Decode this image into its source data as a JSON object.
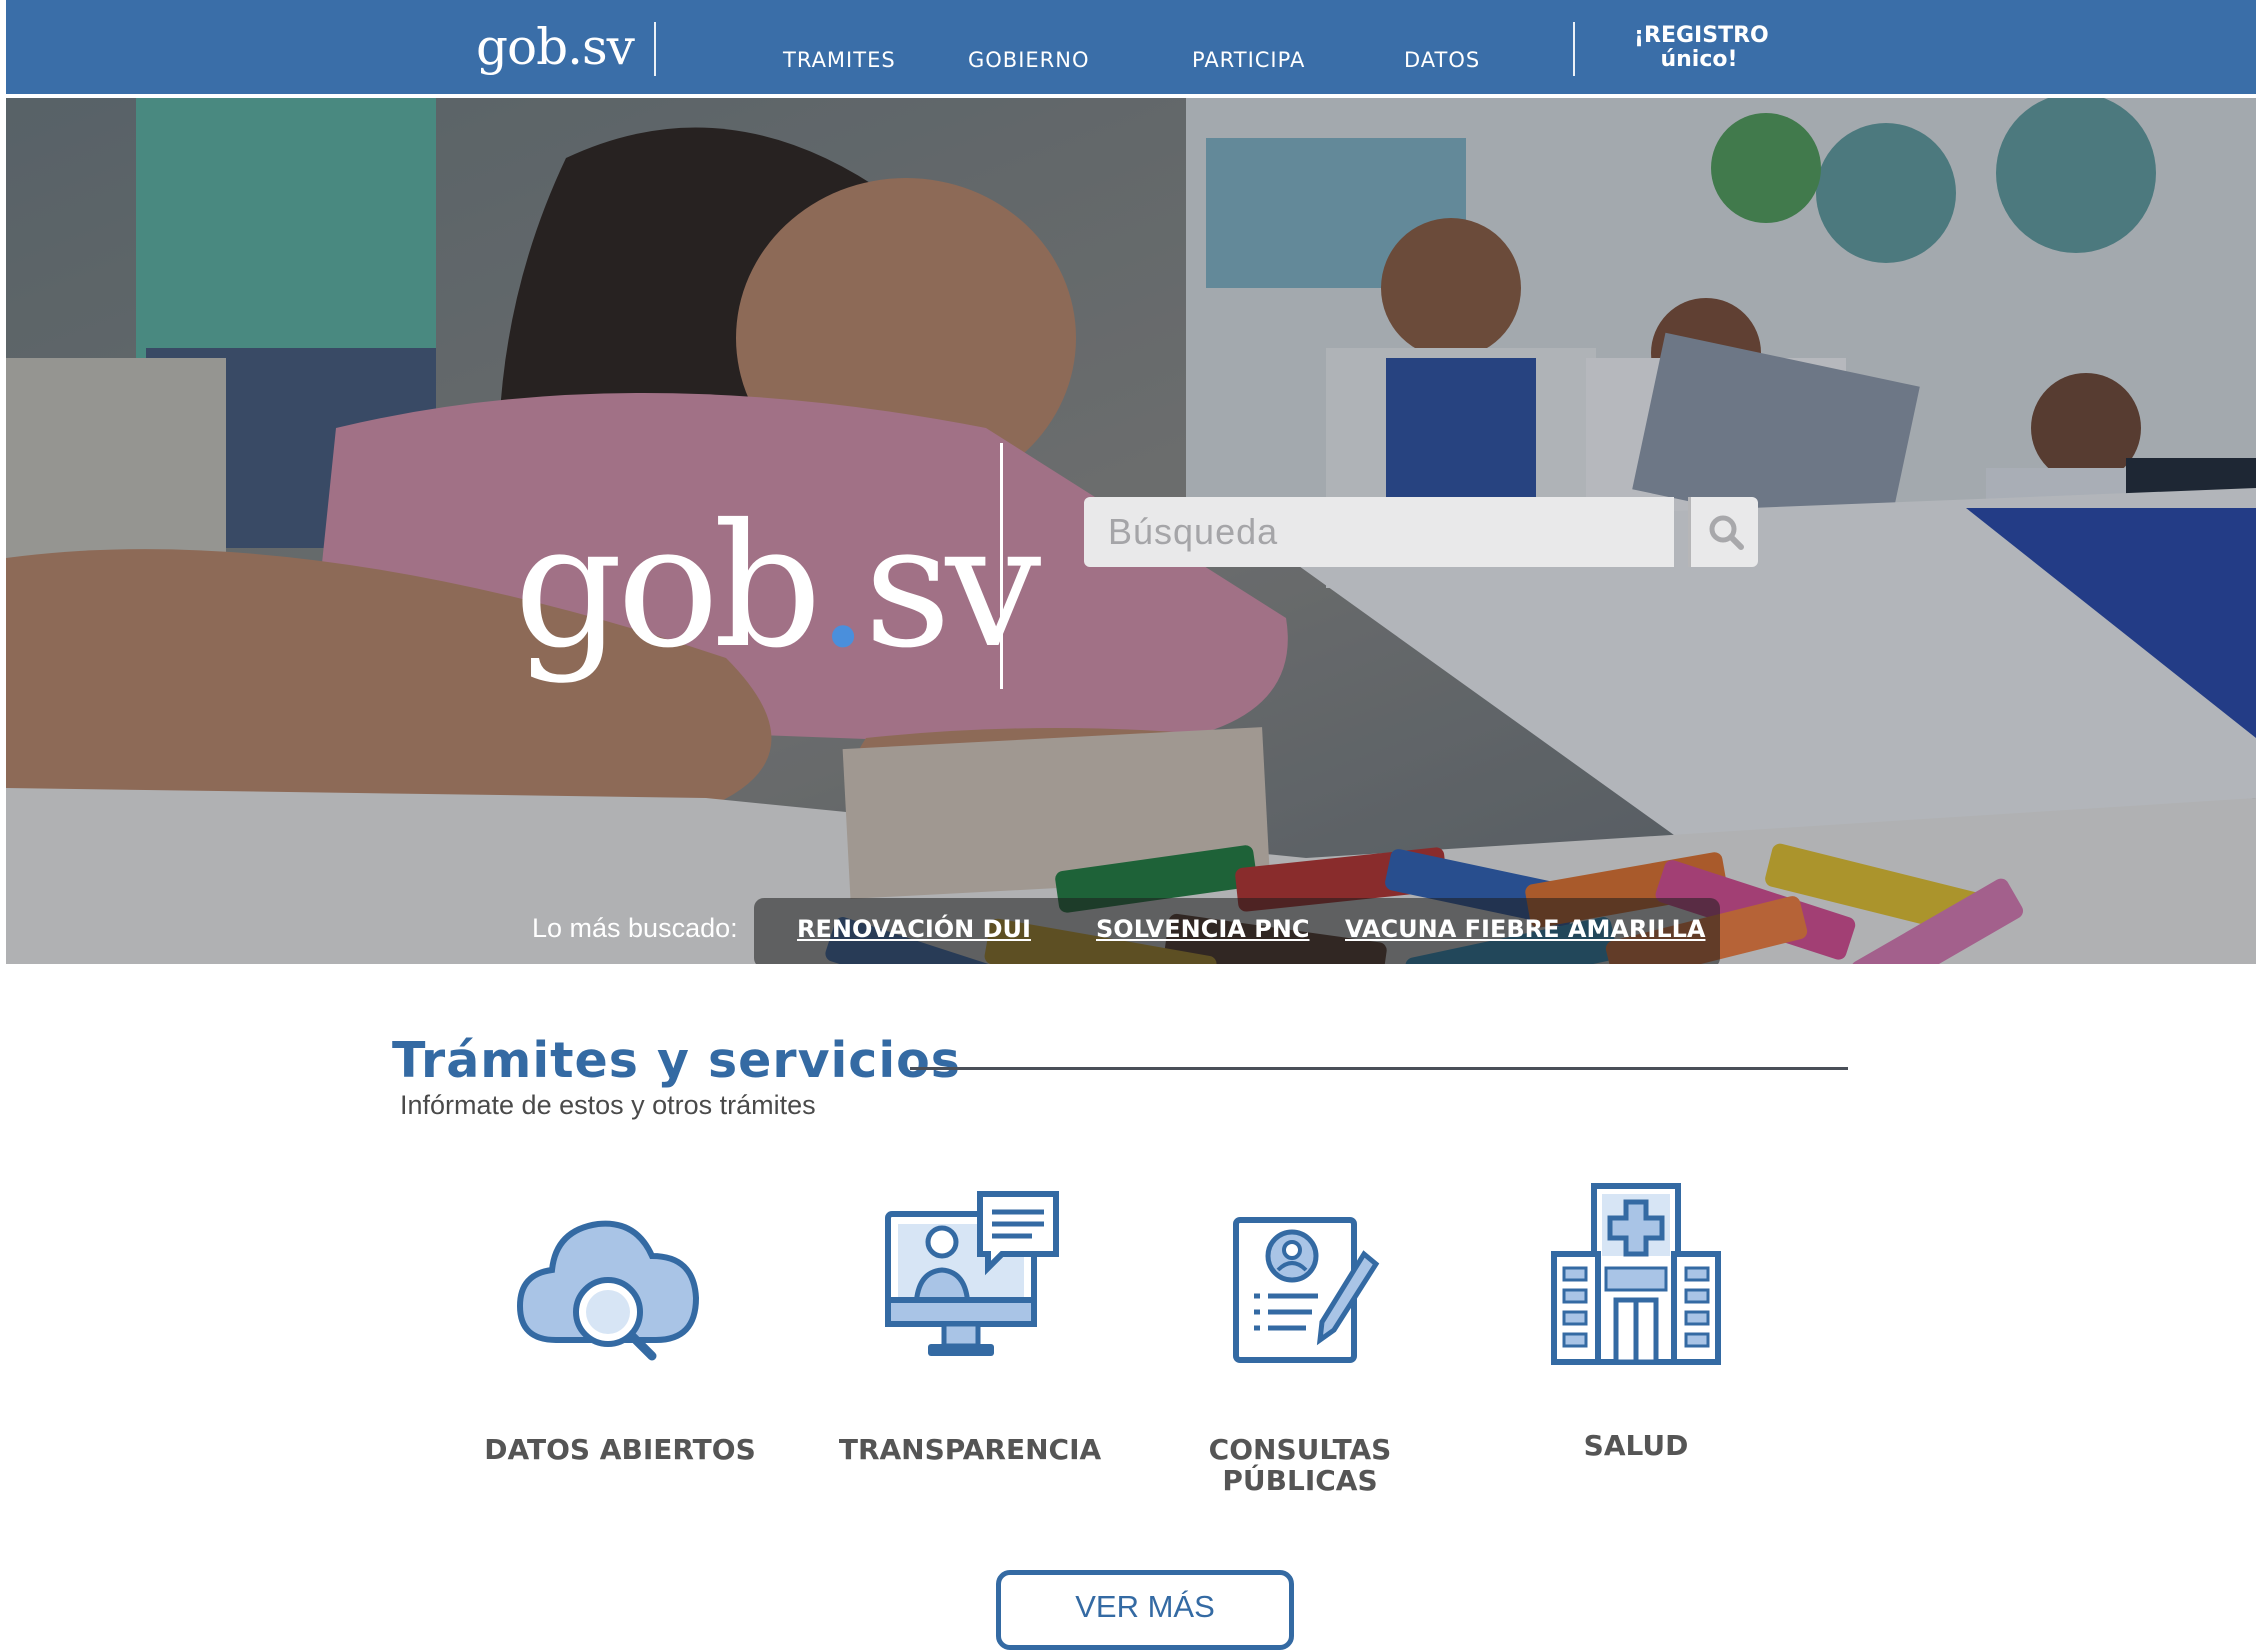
{
  "nav": {
    "logo": "gob.sv",
    "links": [
      "TRAMITES",
      "GOBIERNO",
      "PARTICIPA",
      "DATOS"
    ],
    "registro_line1": "¡REGISTRO",
    "registro_line2": "único!"
  },
  "hero": {
    "logo_main": "gob",
    "logo_dot": ".",
    "logo_tail": "sv",
    "search_placeholder": "Búsqueda",
    "search_icon": "search-icon",
    "popular_label": "Lo más buscado:",
    "popular_links": [
      "RENOVACIÓN DUI",
      "SOLVENCIA PNC",
      "VACUNA FIEBRE AMARILLA"
    ]
  },
  "section": {
    "title": "Trámites y servicios",
    "subtitle": "Infórmate de estos y otros trámites",
    "cards": [
      {
        "label": "DATOS ABIERTOS",
        "icon": "cloud-search-icon"
      },
      {
        "label": "TRANSPARENCIA",
        "icon": "monitor-chat-icon"
      },
      {
        "label_line1": "CONSULTAS",
        "label_line2": "PÚBLICAS",
        "icon": "document-pen-icon"
      },
      {
        "label": "SALUD",
        "icon": "hospital-icon"
      }
    ],
    "more_button": "VER MÁS"
  },
  "colors": {
    "brand_blue": "#3a6ea8",
    "title_blue": "#346aa3",
    "icon_light": "#a9c4e6",
    "hero_dot": "#4a8fdc"
  }
}
